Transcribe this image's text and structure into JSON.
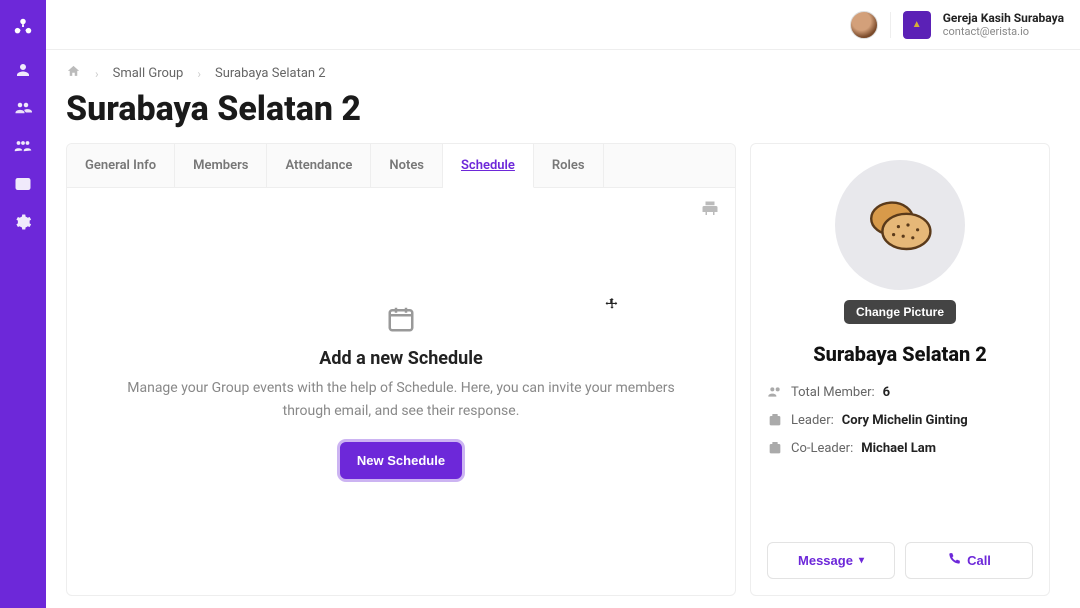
{
  "org": {
    "name": "Gereja Kasih Surabaya",
    "email": "contact@erista.io"
  },
  "breadcrumb": {
    "level1": "Small Group",
    "level2": "Surabaya Selatan 2"
  },
  "page_title": "Surabaya Selatan 2",
  "tabs": {
    "general_info": "General Info",
    "members": "Members",
    "attendance": "Attendance",
    "notes": "Notes",
    "schedule": "Schedule",
    "roles": "Roles"
  },
  "active_tab": "schedule",
  "empty_state": {
    "title": "Add a new Schedule",
    "description": "Manage your Group events with the help of Schedule. Here, you can invite your members through email, and see their response.",
    "button_label": "New Schedule"
  },
  "group_card": {
    "change_picture_label": "Change Picture",
    "name": "Surabaya Selatan 2",
    "total_member_label": "Total Member: ",
    "total_member_value": "6",
    "leader_label": "Leader: ",
    "leader_value": "Cory Michelin Ginting",
    "coleader_label": "Co-Leader: ",
    "coleader_value": "Michael Lam",
    "message_label": "Message",
    "call_label": "Call"
  }
}
